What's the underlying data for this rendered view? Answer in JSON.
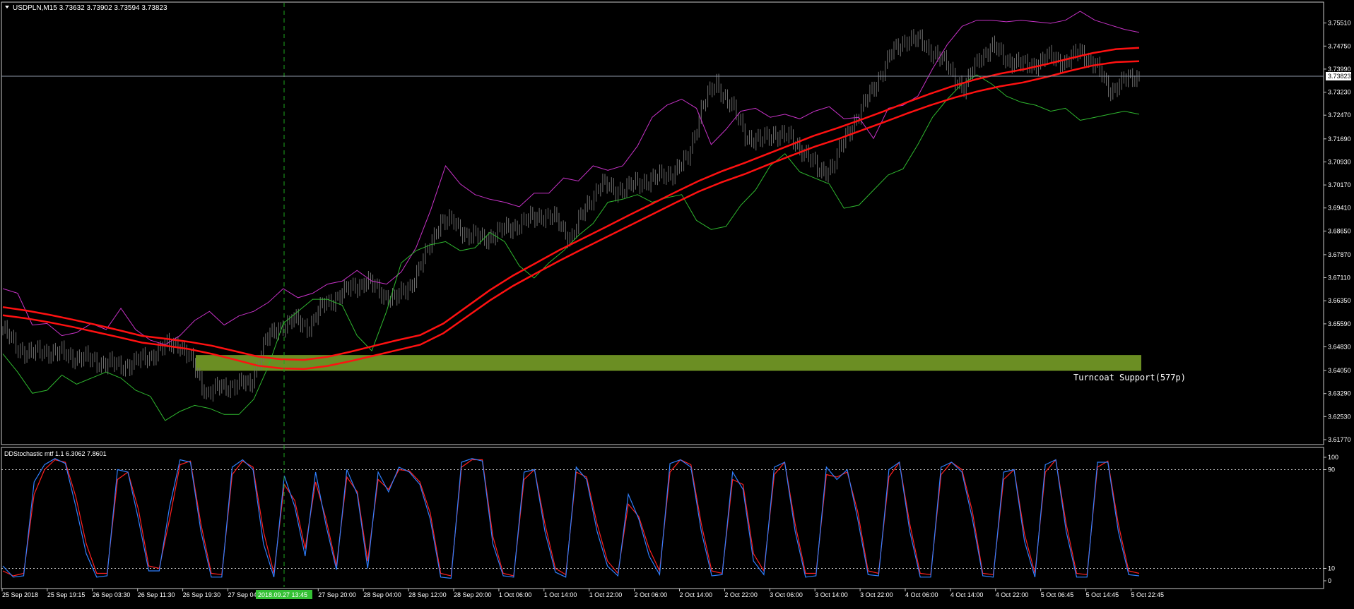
{
  "colors": {
    "background": "#000000",
    "frame": "#c8c8c8",
    "candles": "#6e6e6e",
    "ma_lines": "#ff1111",
    "upper_envelope": "#c832c8",
    "lower_envelope": "#2fb82f",
    "support_zone": "#6b8e23",
    "price_line": "#8e97a8",
    "stoch_main": "#2f7fff",
    "stoch_signal": "#ff2020",
    "crosshair": "#1ea81e",
    "date_highlight": "#34c134"
  },
  "main_panel": {
    "symbol_label": "USDPLN,M15  3.73632 3.73902 3.73594 3.73823",
    "current_price_label": "3.73823",
    "support_zone_label": "Turncoat Support(577p)"
  },
  "stoch_panel": {
    "label": "DDStochastic mtf 1.1 6.3062 7.8601"
  },
  "crosshair_date_label": "2018.09.27 13:45",
  "chart_data": [
    {
      "type": "line",
      "title": "USDPLN,M15",
      "ylim": [
        3.6177,
        3.7585
      ],
      "yticks": [
        "3.75510",
        "3.74750",
        "3.73990",
        "3.73230",
        "3.72470",
        "3.71690",
        "3.70930",
        "3.70170",
        "3.69410",
        "3.68650",
        "3.67870",
        "3.67110",
        "3.66350",
        "3.65590",
        "3.64830",
        "3.64050",
        "3.63290",
        "3.62530",
        "3.61770"
      ],
      "x_labels": [
        "25 Sep 2018",
        "25 Sep 19:15",
        "26 Sep 03:30",
        "26 Sep 11:30",
        "26 Sep 19:30",
        "27 Sep 04:",
        "2018.09.27 13:45",
        "27 Sep 20:00",
        "28 Sep 04:00",
        "28 Sep 12:00",
        "28 Sep 20:00",
        "1 Oct 06:00",
        "1 Oct 14:00",
        "1 Oct 22:00",
        "2 Oct 06:00",
        "2 Oct 14:00",
        "2 Oct 22:00",
        "3 Oct 06:00",
        "3 Oct 14:00",
        "3 Oct 22:00",
        "4 Oct 06:00",
        "4 Oct 14:00",
        "4 Oct 22:00",
        "5 Oct 06:45",
        "5 Oct 14:45",
        "5 Oct 22:45"
      ],
      "current_price": 3.73823,
      "support_zone": {
        "from": 3.6404,
        "to": 3.6456
      },
      "series": [
        {
          "role": "price",
          "values": [
            3.654,
            3.648,
            3.646,
            3.647,
            3.646,
            3.645,
            3.644,
            3.643,
            3.642,
            3.643,
            3.645,
            3.648,
            3.65,
            3.643,
            3.633,
            3.635,
            3.636,
            3.636,
            3.65,
            3.655,
            3.657,
            3.655,
            3.662,
            3.665,
            3.668,
            3.67,
            3.666,
            3.664,
            3.669,
            3.678,
            3.69,
            3.689,
            3.685,
            3.684,
            3.686,
            3.688,
            3.69,
            3.692,
            3.69,
            3.684,
            3.694,
            3.702,
            3.7,
            3.701,
            3.703,
            3.704,
            3.706,
            3.71,
            3.728,
            3.735,
            3.728,
            3.718,
            3.716,
            3.719,
            3.717,
            3.713,
            3.706,
            3.708,
            3.719,
            3.727,
            3.736,
            3.745,
            3.75,
            3.749,
            3.745,
            3.74,
            3.733,
            3.744,
            3.747,
            3.743,
            3.741,
            3.742,
            3.744,
            3.742,
            3.746,
            3.741,
            3.733,
            3.736,
            3.738
          ]
        },
        {
          "role": "ma_upper",
          "values": [
            3.6614,
            3.6603,
            3.6589,
            3.6573,
            3.6556,
            3.6538,
            3.6519,
            3.651,
            3.65,
            3.6487,
            3.6469,
            3.6451,
            3.6442,
            3.644,
            3.645,
            3.6467,
            3.6486,
            3.6505,
            3.6522,
            3.656,
            3.6615,
            3.667,
            3.6718,
            3.676,
            3.6802,
            3.684,
            3.6878,
            3.6917,
            3.6955,
            3.6993,
            3.703,
            3.7062,
            3.709,
            3.712,
            3.715,
            3.718,
            3.7205,
            3.7232,
            3.726,
            3.729,
            3.7318,
            3.7344,
            3.7366,
            3.7384,
            3.7398,
            3.7415,
            3.7434,
            3.7452,
            3.7465,
            3.7469
          ]
        },
        {
          "role": "ma_lower",
          "values": [
            3.6587,
            3.6577,
            3.6564,
            3.6549,
            3.6532,
            3.6515,
            3.6497,
            3.6487,
            3.6476,
            3.646,
            3.6441,
            3.6421,
            3.6412,
            3.641,
            3.642,
            3.6436,
            3.6454,
            3.6472,
            3.649,
            3.6528,
            3.6582,
            3.6636,
            3.6684,
            3.6726,
            3.6767,
            3.6806,
            3.6844,
            3.6882,
            3.692,
            3.6958,
            3.6995,
            3.7026,
            3.7053,
            3.7084,
            3.7114,
            3.7143,
            3.7168,
            3.7196,
            3.7224,
            3.7253,
            3.728,
            3.7304,
            3.7325,
            3.7342,
            3.7355,
            3.7373,
            3.7393,
            3.7411,
            3.7422,
            3.7425
          ]
        },
        {
          "role": "upper_envelope",
          "values": [
            3.6675,
            3.666,
            3.6555,
            3.656,
            3.652,
            3.653,
            3.656,
            3.654,
            3.661,
            3.654,
            3.6505,
            3.649,
            3.652,
            3.657,
            3.66,
            3.6555,
            3.6585,
            3.66,
            3.663,
            3.6675,
            3.6645,
            3.666,
            3.669,
            3.67,
            3.6735,
            3.67,
            3.669,
            3.673,
            3.681,
            3.6935,
            3.708,
            3.702,
            3.6985,
            3.697,
            3.696,
            3.6945,
            3.699,
            3.699,
            3.704,
            3.703,
            3.708,
            3.7065,
            3.708,
            3.7145,
            3.724,
            3.728,
            3.73,
            3.727,
            3.715,
            3.72,
            3.726,
            3.727,
            3.724,
            3.725,
            3.7235,
            3.726,
            3.7275,
            3.7235,
            3.724,
            3.717,
            3.727,
            3.728,
            3.731,
            3.74,
            3.748,
            3.754,
            3.756,
            3.756,
            3.7555,
            3.756,
            3.7555,
            3.755,
            3.756,
            3.759,
            3.756,
            3.7545,
            3.753,
            3.752
          ]
        },
        {
          "role": "lower_envelope",
          "values": [
            3.646,
            3.64,
            3.633,
            3.634,
            3.639,
            3.636,
            3.638,
            3.64,
            3.638,
            3.634,
            3.632,
            3.624,
            3.627,
            3.629,
            3.628,
            3.626,
            3.626,
            3.631,
            3.642,
            3.656,
            3.66,
            3.664,
            3.664,
            3.662,
            3.652,
            3.647,
            3.66,
            3.676,
            3.68,
            3.682,
            3.683,
            3.68,
            3.681,
            3.686,
            3.683,
            3.675,
            3.671,
            3.676,
            3.68,
            3.685,
            3.689,
            3.696,
            3.697,
            3.6985,
            3.696,
            3.6975,
            3.6985,
            3.69,
            3.687,
            3.688,
            3.695,
            3.7,
            3.708,
            3.712,
            3.706,
            3.704,
            3.702,
            3.694,
            3.695,
            3.7,
            3.705,
            3.707,
            3.715,
            3.724,
            3.73,
            3.735,
            3.738,
            3.735,
            3.731,
            3.729,
            3.728,
            3.726,
            3.727,
            3.723,
            3.724,
            3.725,
            3.726,
            3.725
          ]
        }
      ]
    },
    {
      "type": "line",
      "title": "DDStochastic mtf 1.1 6.3062 7.8601",
      "ylim": [
        0,
        100
      ],
      "yticks": [
        "100",
        "90",
        "10",
        "0"
      ],
      "levels": [
        90,
        10
      ],
      "series": [
        {
          "role": "main",
          "values": [
            12,
            3,
            4,
            80,
            94,
            99,
            95,
            60,
            22,
            3,
            4,
            90,
            88,
            50,
            8,
            8,
            60,
            98,
            96,
            40,
            3,
            3,
            92,
            98,
            90,
            30,
            3,
            85,
            60,
            20,
            88,
            45,
            9,
            90,
            70,
            10,
            88,
            72,
            92,
            88,
            78,
            50,
            3,
            2,
            96,
            99,
            97,
            30,
            4,
            3,
            88,
            90,
            40,
            7,
            3,
            92,
            82,
            40,
            12,
            4,
            70,
            50,
            20,
            5,
            95,
            98,
            92,
            40,
            4,
            5,
            88,
            74,
            16,
            5,
            92,
            96,
            40,
            3,
            4,
            92,
            82,
            90,
            50,
            5,
            4,
            90,
            96,
            40,
            3,
            3,
            92,
            96,
            88,
            50,
            4,
            3,
            88,
            90,
            32,
            3,
            94,
            98,
            40,
            3,
            3,
            96,
            96,
            40,
            5,
            4
          ]
        },
        {
          "role": "signal",
          "values": [
            8,
            4,
            6,
            70,
            90,
            98,
            96,
            68,
            30,
            6,
            6,
            82,
            88,
            58,
            12,
            10,
            50,
            94,
            97,
            46,
            6,
            5,
            86,
            97,
            92,
            40,
            6,
            78,
            65,
            26,
            80,
            50,
            12,
            84,
            72,
            16,
            82,
            74,
            90,
            89,
            80,
            55,
            6,
            4,
            92,
            98,
            98,
            36,
            6,
            4,
            82,
            90,
            46,
            10,
            5,
            88,
            84,
            46,
            16,
            6,
            62,
            52,
            26,
            8,
            88,
            98,
            94,
            46,
            8,
            6,
            82,
            78,
            22,
            8,
            86,
            96,
            46,
            6,
            6,
            86,
            84,
            88,
            56,
            8,
            6,
            84,
            96,
            46,
            6,
            5,
            86,
            96,
            90,
            56,
            6,
            5,
            82,
            90,
            38,
            6,
            88,
            98,
            46,
            6,
            5,
            92,
            97,
            46,
            8,
            6
          ]
        }
      ]
    }
  ]
}
